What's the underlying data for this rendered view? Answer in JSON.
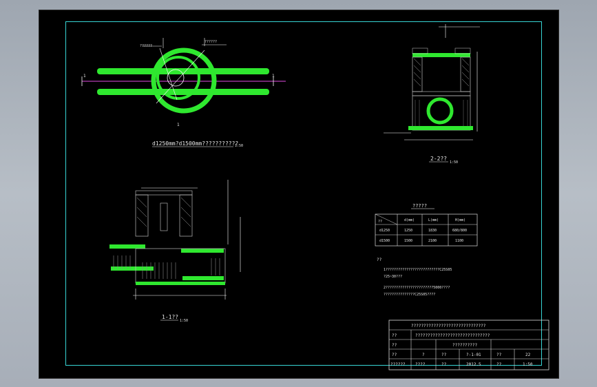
{
  "drawing": {
    "plan_view": {
      "title": "d1250mm?d1500mm???????????",
      "scale": "1:50",
      "section_mark": "1",
      "callout_1": "??????",
      "callout_2": "??????"
    },
    "section_2_2": {
      "title": "2-2??",
      "scale": "1:50"
    },
    "section_1_1": {
      "title": "1-1??",
      "scale": "1:50"
    },
    "table": {
      "title": "?????",
      "headers": [
        "??",
        "d(mm)",
        "L(mm)",
        "H(mm)"
      ],
      "rows": [
        [
          "d1250",
          "1250",
          "1830",
          "680/800"
        ],
        [
          "d1500",
          "1500",
          "2100",
          "1100"
        ]
      ]
    },
    "notes": {
      "title": "??",
      "lines": [
        "1??????????????????????????C25S05",
        "  ?25~30???",
        "2???????????????????????5000????",
        "  ???????????????C25S05????"
      ]
    },
    "title_block": {
      "rows": [
        [
          "??????????????????????????????"
        ],
        [
          "??",
          "??????????????????????????????"
        ],
        [
          "??",
          "",
          "??????????"
        ],
        [
          "??",
          "?",
          "??",
          "?-1-01",
          "??",
          "22"
        ],
        [
          "??????",
          "????",
          "??",
          "2012.5",
          "??",
          "1:50"
        ]
      ]
    }
  }
}
